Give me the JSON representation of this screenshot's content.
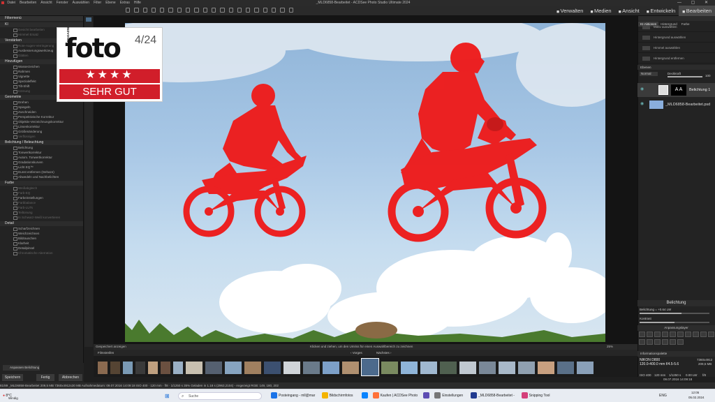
{
  "menu": [
    "Datei",
    "Bearbeiten",
    "Ansicht",
    "Fenster",
    "Auswählen",
    "Filter",
    "Ebene",
    "Extras",
    "Hilfe"
  ],
  "window_title": "_MLD6858-Bearbeitet - ACDSee Photo Studio Ultimate 2024",
  "modes": [
    {
      "label": "Verwalten",
      "icon": "grid-icon"
    },
    {
      "label": "Medien",
      "icon": "media-icon"
    },
    {
      "label": "Ansicht",
      "icon": "eye-icon"
    },
    {
      "label": "Entwickeln",
      "icon": "develop-icon"
    },
    {
      "label": "Bearbeiten",
      "icon": "edit-icon",
      "active": true
    }
  ],
  "left_panel": {
    "title": "Filtermenü",
    "sections": [
      {
        "title": "KI",
        "items": [
          {
            "label": "Gesicht bearbeiten",
            "dim": true
          },
          {
            "label": "Himmel Ersatz",
            "dim": true
          }
        ]
      },
      {
        "title": "Verstärken",
        "items": [
          {
            "label": "Rote-Augen-Verringerung",
            "dim": true
          },
          {
            "label": "Ausbesserungswerkzeug"
          },
          {
            "label": "Glätten",
            "dim": true
          }
        ]
      },
      {
        "title": "Hinzufügen",
        "items": [
          {
            "label": "Wasserzeichen"
          },
          {
            "label": "Rahmen"
          },
          {
            "label": "Vignette"
          },
          {
            "label": "Spezialeffekt"
          },
          {
            "label": "Tilt-Shift"
          },
          {
            "label": "Körnung",
            "dim": true
          }
        ]
      },
      {
        "title": "Geometrie",
        "items": [
          {
            "label": "Drehen"
          },
          {
            "label": "Spiegeln"
          },
          {
            "label": "Zuschneiden"
          },
          {
            "label": "Perspektivische Korrektur"
          },
          {
            "label": "Objektiv-Verzeichnungskorrektur"
          },
          {
            "label": "Linsenkorrektur"
          },
          {
            "label": "Größenänderung"
          },
          {
            "label": "Verflüssigen",
            "dim": true
          }
        ]
      },
      {
        "title": "Belichtung / Beleuchtung",
        "items": [
          {
            "label": "Belichtung"
          },
          {
            "label": "Tonwertkorrektur"
          },
          {
            "label": "Autom. Tonwertkorrektur"
          },
          {
            "label": "Gradationskurven"
          },
          {
            "label": "Licht EQ™"
          },
          {
            "label": "Dunst entfernen (Dehaze)"
          },
          {
            "label": "Abwedeln und Nachbelichten"
          }
        ]
      },
      {
        "title": "Farbe",
        "items": [
          {
            "label": "Weißabgleich",
            "dim": true
          },
          {
            "label": "Farb-EQ",
            "dim": true
          },
          {
            "label": "Farbeinstellungen"
          },
          {
            "label": "Farbbalance",
            "dim": true
          },
          {
            "label": "Farb-LUTs",
            "dim": true
          },
          {
            "label": "Teiltonung",
            "dim": true
          },
          {
            "label": "In Schwarz-Weiß konvertieren",
            "dim": true
          }
        ]
      },
      {
        "title": "Detail",
        "items": [
          {
            "label": "Scharfzeichnen"
          },
          {
            "label": "Weichzeichnen"
          },
          {
            "label": "Bildrauschen"
          },
          {
            "label": "Klarheit"
          },
          {
            "label": "Detailpinsel"
          },
          {
            "label": "Chromatische Aberration",
            "dim": true
          }
        ]
      }
    ]
  },
  "badge": {
    "magazin": "MAGAZIN",
    "brand": "foto",
    "issue": "4/24",
    "stars": "★★★★",
    "rating": "SEHR GUT"
  },
  "bottom_left": {
    "adjust": "Anpassen Belichtung",
    "save": "Speichern",
    "done": "Fertig",
    "cancel": "Abbrechen"
  },
  "photo_status": {
    "left": "Gespeichert anzeigen",
    "hint": "Klicken und ziehen, um den Umriss für einen Auswahlbereich zu zeichnen",
    "zoom": "25%"
  },
  "filmstrip": {
    "label": "Filmstreifen",
    "prev": "Vorges",
    "next": "Nächstes"
  },
  "right_panel": {
    "tabs": [
      "KI-Aktionen",
      "Hintergrund",
      "Farbe"
    ],
    "actions": [
      "Motiv auswählen",
      "Hintergrund auswählen",
      "Himmel auswählen",
      "Hintergrund entfernen"
    ],
    "layers_title": "Ebenen",
    "blend": "Normal",
    "opacity": "Deckkraft",
    "opacity_value": "100",
    "layers": [
      {
        "name": "Belichtung 1",
        "thumb": "A A"
      },
      {
        "name": "_MLD6858-Bearbeitet.psd",
        "thumb": ""
      }
    ],
    "adjust_title": "Belichtung",
    "exposure_label": "Belichtung = +0.64 LW",
    "contrast_label": "Kontrast",
    "adjust_layers": "Anpassungslayer",
    "info_title": "Informationspalette",
    "info_camera": "NIKON D800",
    "info_lens": "120.0-400.0 mm f/4.5-5.6",
    "info_size": "7360x4912",
    "info_mb": "209,5 MB",
    "info_iso": "ISO 400",
    "info_focal": "120 mm",
    "info_shutter": "1/1250 s",
    "info_ev": "0.00 LW",
    "info_fnum": "f/8",
    "info_date": "09.07.2016 14:09:18"
  },
  "status_bar": "81/89   _MLD6858-Bearbeitet   209,5 MB   7360x4912x30 MB   Aufnahmedatum: 09.07.2016 14:09:18   ISO 400 · 120 mm · f/8 · 1/1250 s   35%   Geladen in 1.18 s   (2963,2104) - Angezeigt RGB: 149, 180, 202",
  "taskbar": {
    "weather_temp": "8°C",
    "weather_desc": "Windig",
    "search": "Suche",
    "apps": [
      {
        "label": "Posteingang - mll@mar",
        "color": "#1a73e8"
      },
      {
        "label": "Bildschirmfotos",
        "color": "#f4b400"
      },
      {
        "label": "",
        "color": "#0a84ff"
      },
      {
        "label": "Kaufen | ACDSee Photo",
        "color": "#ff7139"
      },
      {
        "label": "",
        "color": "#5d4db3"
      },
      {
        "label": "Einstellungen",
        "color": "#777"
      },
      {
        "label": "_MLD6858-Bearbeitet -",
        "color": "#203a8f"
      },
      {
        "label": "Snipping Tool",
        "color": "#d43f7a"
      }
    ],
    "lang": "ENG",
    "time": "12:05",
    "date": "05.02.2024"
  }
}
